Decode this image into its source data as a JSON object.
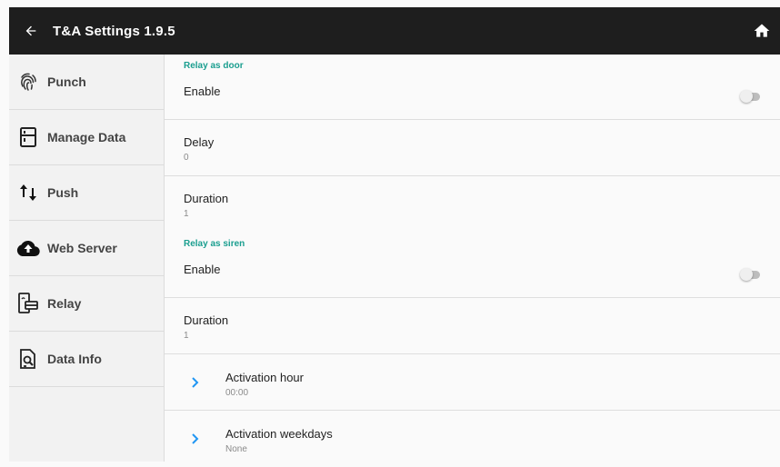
{
  "topbar": {
    "title": "T&A Settings 1.9.5",
    "back_icon": "arrow-left-icon",
    "home_icon": "home-icon"
  },
  "sidebar": {
    "items": [
      {
        "label": "Punch",
        "icon": "fingerprint-icon"
      },
      {
        "label": "Manage Data",
        "icon": "fridge-icon"
      },
      {
        "label": "Push",
        "icon": "swap-vertical-icon"
      },
      {
        "label": "Web Server",
        "icon": "cloud-upload-icon"
      },
      {
        "label": "Relay",
        "icon": "relay-door-icon"
      },
      {
        "label": "Data Info",
        "icon": "file-search-icon"
      }
    ]
  },
  "content": {
    "door_section": {
      "title": "Relay as door",
      "enable_label": "Enable",
      "enable_on": false,
      "delay_label": "Delay",
      "delay_value": "0",
      "duration_label": "Duration",
      "duration_value": "1"
    },
    "siren_section": {
      "title": "Relay as siren",
      "enable_label": "Enable",
      "enable_on": false,
      "duration_label": "Duration",
      "duration_value": "1",
      "activation_hour_label": "Activation hour",
      "activation_hour_value": "00:00",
      "activation_weekdays_label": "Activation weekdays",
      "activation_weekdays_value": "None"
    }
  },
  "colors": {
    "topbar_bg": "#1e1e1e",
    "accent": "#1a9e8f",
    "chevron": "#2196f3"
  }
}
